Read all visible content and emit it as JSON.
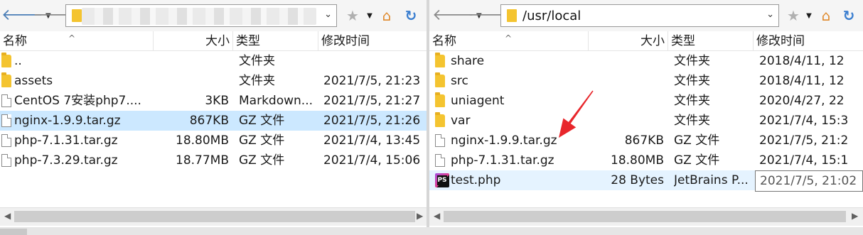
{
  "left": {
    "path": "",
    "columns": {
      "name": "名称",
      "size": "大小",
      "type": "类型",
      "modified": "修改时间"
    },
    "rows": [
      {
        "icon": "folder",
        "name": "..",
        "size": "",
        "type": "文件夹",
        "modified": ""
      },
      {
        "icon": "folder",
        "name": "assets",
        "size": "",
        "type": "文件夹",
        "modified": "2021/7/5, 21:23"
      },
      {
        "icon": "file",
        "name": "CentOS 7安装php7....",
        "size": "3KB",
        "type": "Markdown...",
        "modified": "2021/7/5, 21:27"
      },
      {
        "icon": "file",
        "name": "nginx-1.9.9.tar.gz",
        "size": "867KB",
        "type": "GZ 文件",
        "modified": "2021/7/5, 21:26"
      },
      {
        "icon": "file",
        "name": "php-7.1.31.tar.gz",
        "size": "18.80MB",
        "type": "GZ 文件",
        "modified": "2021/7/4, 13:45"
      },
      {
        "icon": "file",
        "name": "php-7.3.29.tar.gz",
        "size": "18.77MB",
        "type": "GZ 文件",
        "modified": "2021/7/4, 15:06"
      }
    ],
    "selected_index": 3
  },
  "right": {
    "path": "/usr/local",
    "columns": {
      "name": "名称",
      "size": "大小",
      "type": "类型",
      "modified": "修改时间"
    },
    "rows": [
      {
        "icon": "folder",
        "name": "share",
        "size": "",
        "type": "文件夹",
        "modified": "2018/4/11, 12"
      },
      {
        "icon": "folder",
        "name": "src",
        "size": "",
        "type": "文件夹",
        "modified": "2018/4/11, 12"
      },
      {
        "icon": "folder",
        "name": "uniagent",
        "size": "",
        "type": "文件夹",
        "modified": "2020/4/27, 22"
      },
      {
        "icon": "folder",
        "name": "var",
        "size": "",
        "type": "文件夹",
        "modified": "2021/7/4, 15:3"
      },
      {
        "icon": "file",
        "name": "nginx-1.9.9.tar.gz",
        "size": "867KB",
        "type": "GZ 文件",
        "modified": "2021/7/5, 21:2"
      },
      {
        "icon": "file",
        "name": "php-7.1.31.tar.gz",
        "size": "18.80MB",
        "type": "GZ 文件",
        "modified": "2021/7/4, 15:1"
      },
      {
        "icon": "phpstorm",
        "name": "test.php",
        "size": "28 Bytes",
        "type": "JetBrains P...",
        "modified": ""
      }
    ],
    "hover_index": 6
  },
  "tooltip": "2021/7/5, 21:02",
  "colors": {
    "selection": "#cce8ff",
    "hover": "#e5f3ff",
    "folder": "#f4c430",
    "annotation_arrow": "#e8262b"
  }
}
